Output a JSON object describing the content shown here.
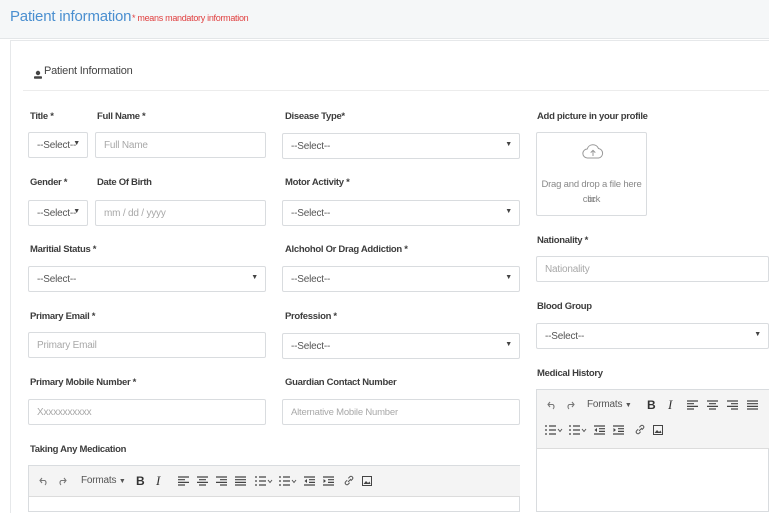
{
  "header": {
    "title": "Patient information",
    "mandatory_note": "* means mandatory information"
  },
  "section": {
    "title": "Patient Information"
  },
  "fields": {
    "title": {
      "label": "Title *",
      "value": "--Select--"
    },
    "full_name": {
      "label": "Full Name *",
      "placeholder": "Full Name"
    },
    "disease_type": {
      "label": "Disease Type*",
      "value": "--Select--"
    },
    "gender": {
      "label": "Gender *",
      "value": "--Select--"
    },
    "date_of_birth": {
      "label": "Date Of Birth",
      "placeholder": "mm / dd / yyyy"
    },
    "motor_activity": {
      "label": "Motor Activity *",
      "value": "--Select--"
    },
    "marital_status": {
      "label": "Maritial Status *",
      "value": "--Select--"
    },
    "addiction": {
      "label": "Alchohol Or Drag Addiction *",
      "value": "--Select--"
    },
    "primary_email": {
      "label": "Primary Email *",
      "placeholder": "Primary Email"
    },
    "profession": {
      "label": "Profession *",
      "value": "--Select--"
    },
    "primary_mobile": {
      "label": "Primary Mobile Number *",
      "placeholder": "Xxxxxxxxxxx"
    },
    "guardian_contact": {
      "label": "Guardian Contact Number",
      "placeholder": "Alternative Mobile Number"
    },
    "taking_medication": {
      "label": "Taking Any Medication"
    },
    "profile_picture": {
      "label": "Add picture in your profile",
      "dropzone_line1": "Drag and drop a file here or",
      "dropzone_line2": "click"
    },
    "nationality": {
      "label": "Nationality *",
      "placeholder": "Nationality"
    },
    "blood_group": {
      "label": "Blood Group",
      "value": "--Select--"
    },
    "medical_history": {
      "label": "Medical History"
    }
  },
  "editor_toolbar": {
    "formats_label": "Formats",
    "bold": "B",
    "italic": "I",
    "icons": [
      "undo-icon",
      "redo-icon",
      "align-left-icon",
      "align-center-icon",
      "align-right-icon",
      "align-justify-icon",
      "bullet-list-icon",
      "numbered-list-icon",
      "outdent-icon",
      "indent-icon",
      "link-icon",
      "image-icon"
    ]
  },
  "colors": {
    "title_blue": "#4a8fd0",
    "mandatory_red": "#e04040",
    "border": "#d9dcdf"
  }
}
